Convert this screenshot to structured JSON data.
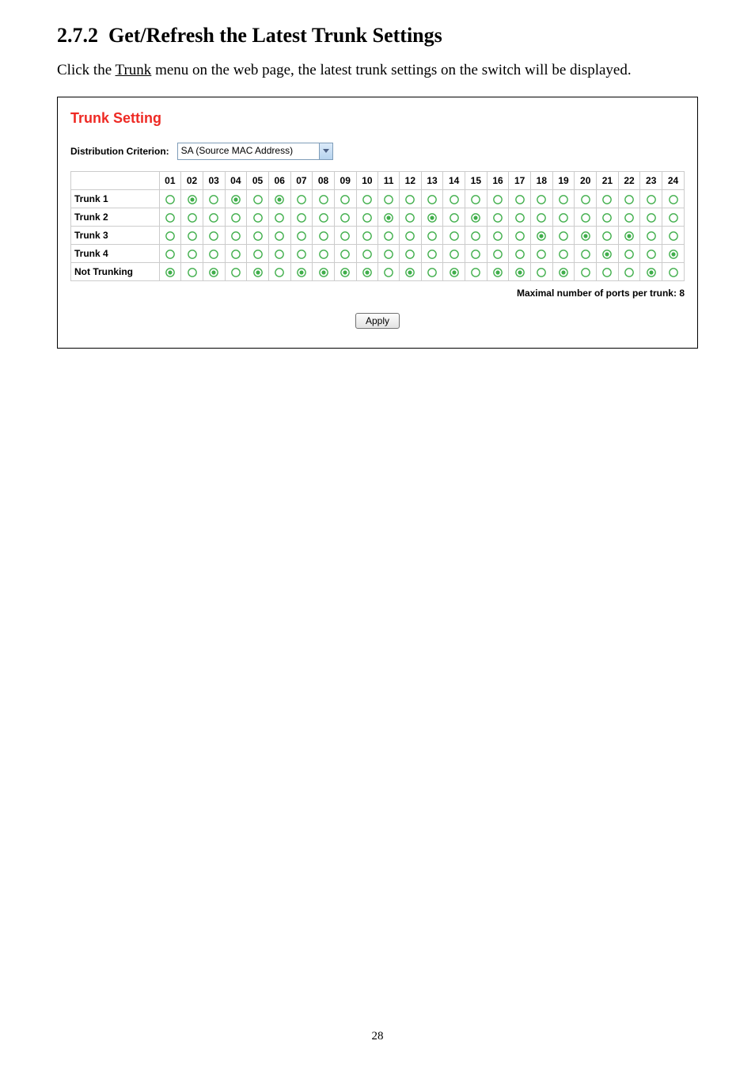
{
  "section_number": "2.7.2",
  "section_title": "Get/Refresh the Latest Trunk Settings",
  "body_before": "Click the ",
  "body_link": "Trunk",
  "body_after": " menu on the web page, the latest trunk settings on the switch will be displayed.",
  "panel": {
    "title": "Trunk Setting",
    "dist_label": "Distribution Criterion:",
    "dist_value": "SA (Source MAC Address)",
    "columns": [
      "01",
      "02",
      "03",
      "04",
      "05",
      "06",
      "07",
      "08",
      "09",
      "10",
      "11",
      "12",
      "13",
      "14",
      "15",
      "16",
      "17",
      "18",
      "19",
      "20",
      "21",
      "22",
      "23",
      "24"
    ],
    "rows": [
      {
        "label": "Trunk 1",
        "selected": [
          2,
          4,
          6
        ]
      },
      {
        "label": "Trunk 2",
        "selected": [
          11,
          13,
          15
        ]
      },
      {
        "label": "Trunk 3",
        "selected": [
          18,
          20,
          22
        ]
      },
      {
        "label": "Trunk 4",
        "selected": [
          21,
          24
        ]
      },
      {
        "label": "Not Trunking",
        "selected": [
          1,
          3,
          5,
          7,
          8,
          9,
          10,
          12,
          14,
          16,
          17,
          19,
          23
        ]
      }
    ],
    "max_note": "Maximal number of ports per trunk: 8",
    "apply_label": "Apply"
  },
  "page_number": "28"
}
